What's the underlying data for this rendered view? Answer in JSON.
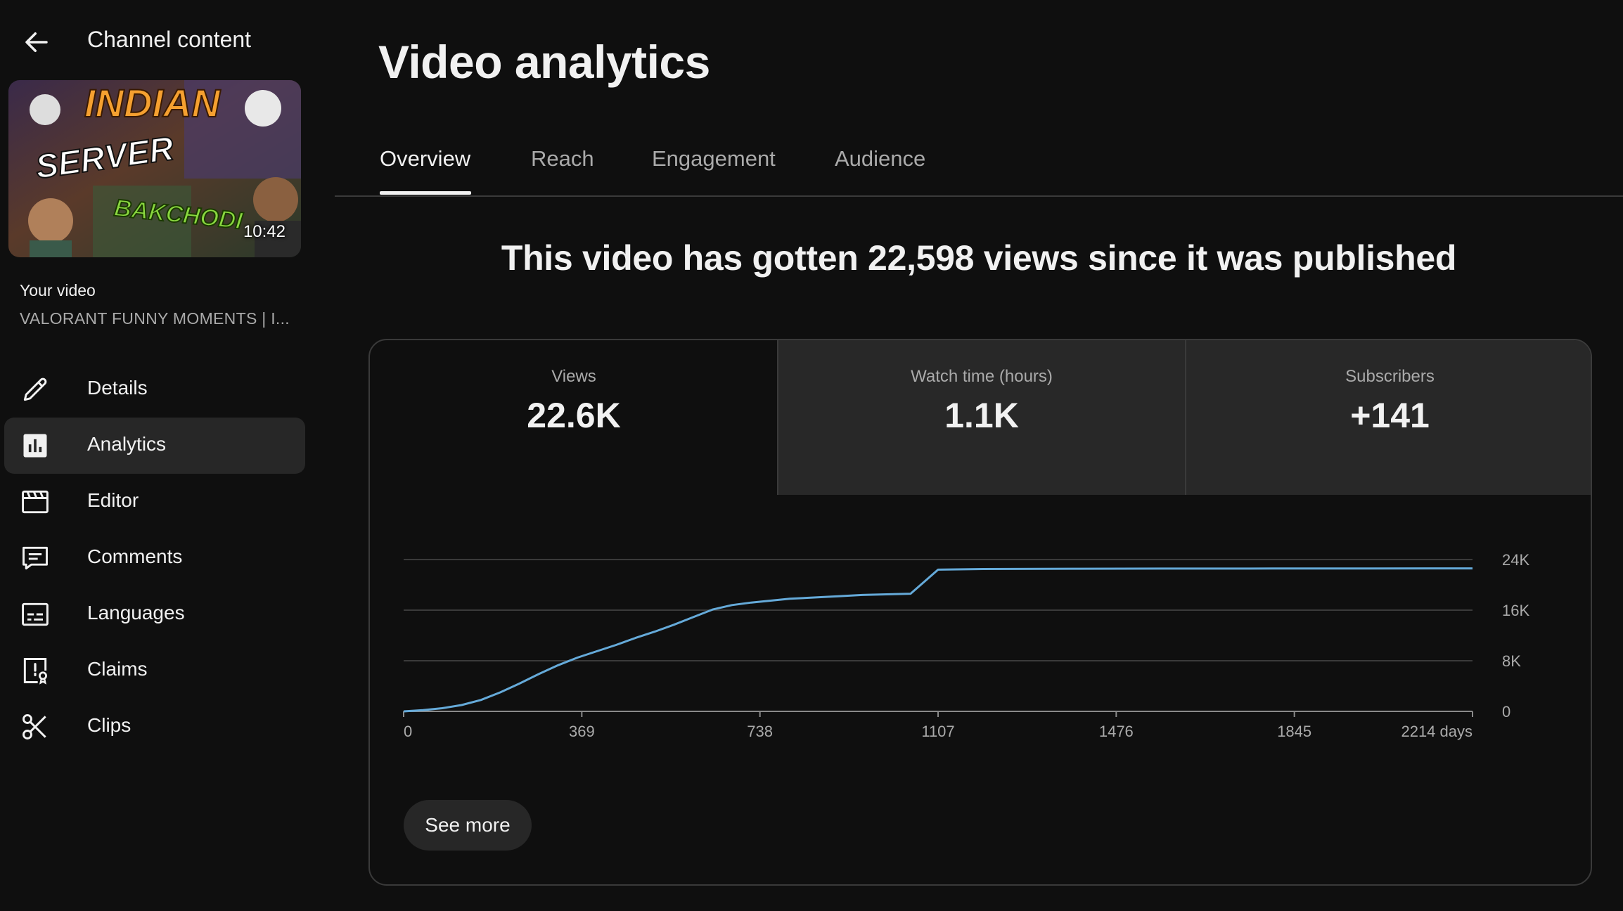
{
  "sidebar": {
    "back_title": "Channel content",
    "thumbnail": {
      "duration": "10:42",
      "text_line1": "INDIAN",
      "text_line2": "SERVER",
      "text_line3": "BAKCHODI"
    },
    "your_video_label": "Your video",
    "video_title": "VALORANT FUNNY MOMENTS | I...",
    "nav": [
      {
        "label": "Details",
        "icon": "pencil-icon",
        "active": false
      },
      {
        "label": "Analytics",
        "icon": "analytics-icon",
        "active": true
      },
      {
        "label": "Editor",
        "icon": "clapperboard-icon",
        "active": false
      },
      {
        "label": "Comments",
        "icon": "comment-icon",
        "active": false
      },
      {
        "label": "Languages",
        "icon": "subtitles-icon",
        "active": false
      },
      {
        "label": "Claims",
        "icon": "claims-icon",
        "active": false
      },
      {
        "label": "Clips",
        "icon": "scissors-icon",
        "active": false
      }
    ]
  },
  "main": {
    "title": "Video analytics",
    "tabs": [
      {
        "label": "Overview",
        "active": true
      },
      {
        "label": "Reach",
        "active": false
      },
      {
        "label": "Engagement",
        "active": false
      },
      {
        "label": "Audience",
        "active": false
      }
    ],
    "headline": "This video has gotten 22,598 views since it was published",
    "metrics": [
      {
        "label": "Views",
        "value": "22.6K",
        "selected": true
      },
      {
        "label": "Watch time (hours)",
        "value": "1.1K",
        "selected": false
      },
      {
        "label": "Subscribers",
        "value": "+141",
        "selected": false
      }
    ],
    "see_more_label": "See more"
  },
  "colors": {
    "background": "#0f0f0f",
    "active_nav": "#272727",
    "inactive_metric": "#282828",
    "line": "#65aad9",
    "grid": "#3a3a3a"
  },
  "chart_data": {
    "type": "line",
    "x_tick_labels": [
      "0",
      "369",
      "738",
      "1107",
      "1476",
      "1845",
      "2214 days"
    ],
    "y_tick_labels": [
      "24K",
      "16K",
      "8K",
      "0"
    ],
    "xlim": [
      0,
      2214
    ],
    "ylim": [
      0,
      24000
    ],
    "grid": true,
    "series": [
      {
        "x": [
          0,
          40,
          80,
          120,
          160,
          200,
          240,
          280,
          320,
          360,
          400,
          440,
          480,
          520,
          560,
          600,
          640,
          680,
          720,
          760,
          800,
          850,
          900,
          950,
          1000,
          1050,
          1107,
          1200,
          1400,
          1600,
          1800,
          2000,
          2214
        ],
        "y": [
          0,
          200,
          500,
          1000,
          1800,
          3000,
          4400,
          5900,
          7300,
          8500,
          9500,
          10500,
          11600,
          12600,
          13700,
          14900,
          16100,
          16800,
          17200,
          17500,
          17800,
          18000,
          18200,
          18400,
          18500,
          18600,
          22400,
          22500,
          22550,
          22570,
          22580,
          22590,
          22598
        ]
      }
    ]
  }
}
